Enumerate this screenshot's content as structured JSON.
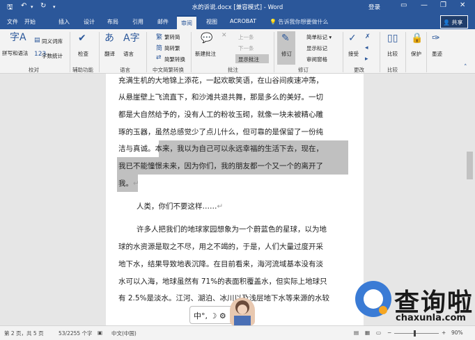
{
  "window": {
    "title": "水的诉说.docx [兼容模式] - Word",
    "login": "登录",
    "quick_access": {
      "save_icon": "save-icon",
      "undo_icon": "undo-icon",
      "redo_icon": "redo-icon",
      "customize_icon": "chevron-down-icon"
    },
    "controls": {
      "ribbon_options": "▭",
      "minimize": "—",
      "restore": "❐",
      "close": "✕"
    }
  },
  "tabs": [
    "文件",
    "开始",
    "插入",
    "设计",
    "布局",
    "引用",
    "邮件",
    "审阅",
    "视图",
    "ACROBAT"
  ],
  "active_tab": "审阅",
  "tell_me": "告诉我你想要做什么",
  "share": "共享",
  "ribbon": {
    "proofing": {
      "label": "校对",
      "spelling": "拼写和语法",
      "thesaurus": "同义词库",
      "wordcount": "字数统计"
    },
    "accessibility": {
      "label": "辅助功能",
      "check": "检查\n辅助功能"
    },
    "language": {
      "label": "语言",
      "translate": "翻译",
      "language": "语言"
    },
    "chinese_conversion": {
      "label": "中文简繁转换",
      "to_simplified": "繁转简",
      "to_traditional": "简转繁",
      "convert": "简繁转换"
    },
    "comments": {
      "label": "批注",
      "new": "新建批注",
      "prev": "上一条",
      "next": "下一条",
      "show": "显示批注"
    },
    "tracking": {
      "label": "修订",
      "track": "修订",
      "markup": "简单标记",
      "show_markup": "显示标记",
      "pane": "审阅窗格"
    },
    "changes": {
      "label": "更改",
      "accept": "接受"
    },
    "compare": {
      "label": "比较",
      "compare": "比较"
    },
    "protect": {
      "protect": "保护"
    },
    "ink": {
      "ink": "墨迹"
    }
  },
  "document": {
    "lines": [
      "充满生机的大地锦上添花，一起欢歌笑语，在山谷间疾速冲荡，",
      "从悬崖壁上飞流直下，和沙滩共退共舞，那是多么的美好。一切",
      "都是大自然给予的，没有人工的粉妆玉砌，就像一块未被精心雕",
      "琢的玉器，虽然总感觉少了点儿什么，但可靠的是保留了一份纯",
      "洁与真诚。本来，我以为自己可以永远幸福的生活下去，现在，",
      "我已不能憧憬未来，因为你们，我的朋友都一个又一个的离开了",
      "我。",
      "人类，你们不要这样……",
      "许多人把我们的地球家园想象为一个蔚蓝色的星球，以为地",
      "球的水资源是取之不尽，用之不竭的，于是，人们大量过度开采",
      "地下水，结果导致地表沉降。在目前看来，海河流域基本没有淡",
      "水可以入海，地球虽然有 71%的表面积覆盖水，但实际上地球只",
      "有 2.5%是淡水。江河、湖泊、冰川以及浅层地下水等来源的水较"
    ]
  },
  "status": {
    "page": "第 2 页，共 5 页",
    "words": "53/2255 个字",
    "language": "中文(中国)",
    "zoom": "90%"
  },
  "ime": {
    "label": "中°, ☽ ⚙"
  },
  "watermark": {
    "text": "查询啦",
    "url": "chaxunla.com"
  },
  "colors": {
    "titlebar": "#2b579a",
    "ribbon": "#f3f3f3",
    "selection": "#c0c0c0",
    "watermark_blue": "#3a7bd5",
    "watermark_orange": "#f5a623"
  }
}
